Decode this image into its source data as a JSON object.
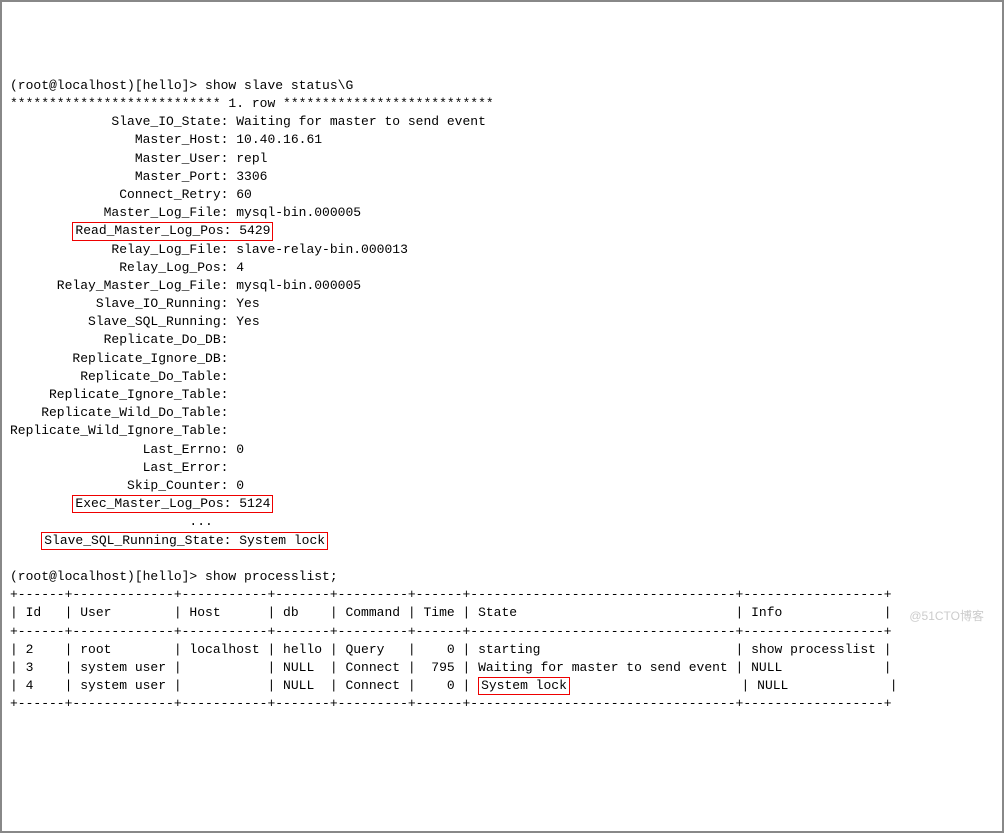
{
  "prompt1": "(root@localhost)[hello]> show slave status\\G",
  "row_sep": "*************************** 1. row ***************************",
  "status": [
    {
      "k": "Slave_IO_State",
      "v": "Waiting for master to send event",
      "hl": false
    },
    {
      "k": "Master_Host",
      "v": "10.40.16.61",
      "hl": false
    },
    {
      "k": "Master_User",
      "v": "repl",
      "hl": false
    },
    {
      "k": "Master_Port",
      "v": "3306",
      "hl": false
    },
    {
      "k": "Connect_Retry",
      "v": "60",
      "hl": false
    },
    {
      "k": "Master_Log_File",
      "v": "mysql-bin.000005",
      "hl": false
    },
    {
      "k": "Read_Master_Log_Pos",
      "v": "5429",
      "hl": true
    },
    {
      "k": "Relay_Log_File",
      "v": "slave-relay-bin.000013",
      "hl": false
    },
    {
      "k": "Relay_Log_Pos",
      "v": "4",
      "hl": false
    },
    {
      "k": "Relay_Master_Log_File",
      "v": "mysql-bin.000005",
      "hl": false
    },
    {
      "k": "Slave_IO_Running",
      "v": "Yes",
      "hl": false
    },
    {
      "k": "Slave_SQL_Running",
      "v": "Yes",
      "hl": false
    },
    {
      "k": "Replicate_Do_DB",
      "v": "",
      "hl": false
    },
    {
      "k": "Replicate_Ignore_DB",
      "v": "",
      "hl": false
    },
    {
      "k": "Replicate_Do_Table",
      "v": "",
      "hl": false
    },
    {
      "k": "Replicate_Ignore_Table",
      "v": "",
      "hl": false
    },
    {
      "k": "Replicate_Wild_Do_Table",
      "v": "",
      "hl": false
    },
    {
      "k": "Replicate_Wild_Ignore_Table",
      "v": "",
      "hl": false
    },
    {
      "k": "Last_Errno",
      "v": "0",
      "hl": false
    },
    {
      "k": "Last_Error",
      "v": "",
      "hl": false
    },
    {
      "k": "Skip_Counter",
      "v": "0",
      "hl": false
    },
    {
      "k": "Exec_Master_Log_Pos",
      "v": "5124",
      "hl": true
    }
  ],
  "ellipsis_line": "                       ...",
  "final_status": {
    "k": "Slave_SQL_Running_State",
    "v": "System lock"
  },
  "prompt2": "(root@localhost)[hello]> show processlist;",
  "table_sep": "+------+-------------+-----------+-------+---------+------+----------------------------------+------------------+",
  "th": {
    "id": "Id",
    "user": "User",
    "host": "Host",
    "db": "db",
    "command": "Command",
    "time": "Time",
    "state": "State",
    "info": "Info"
  },
  "rows": [
    {
      "id": "2",
      "user": "root",
      "host": "localhost",
      "db": "hello",
      "command": "Query",
      "time": "0",
      "state": "starting",
      "info": "show processlist",
      "hl_state": false
    },
    {
      "id": "3",
      "user": "system user",
      "host": "",
      "db": "NULL",
      "command": "Connect",
      "time": "795",
      "state": "Waiting for master to send event",
      "info": "NULL",
      "hl_state": false
    },
    {
      "id": "4",
      "user": "system user",
      "host": "",
      "db": "NULL",
      "command": "Connect",
      "time": "0",
      "state": "System lock",
      "info": "NULL",
      "hl_state": true
    }
  ],
  "watermark": "@51CTO博客"
}
